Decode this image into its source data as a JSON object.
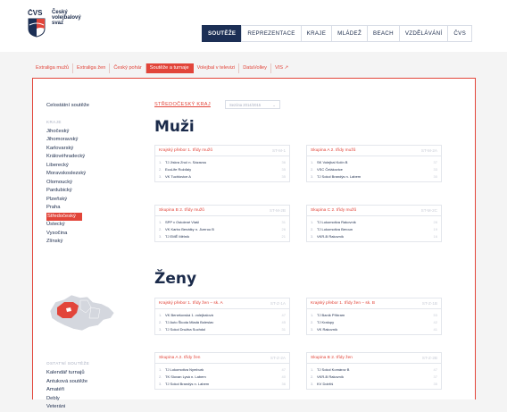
{
  "logo": {
    "line1": "ČVS",
    "line2": "Český",
    "line3": "volejbalový",
    "line4": "svaz"
  },
  "nav": [
    {
      "label": "SOUTĚŽE",
      "active": true
    },
    {
      "label": "REPREZENTACE"
    },
    {
      "label": "KRAJE"
    },
    {
      "label": "MLÁDEŽ"
    },
    {
      "label": "BEACH"
    },
    {
      "label": "VZDĚLÁVÁNÍ"
    },
    {
      "label": "ČVS"
    }
  ],
  "subnav": [
    {
      "label": "Extraliga mužů"
    },
    {
      "label": "Extraliga žen"
    },
    {
      "label": "Český pohár"
    },
    {
      "label": "Soutěže a turnaje",
      "active": true
    },
    {
      "label": "Volejbal v televizi"
    },
    {
      "label": "DataVolley"
    },
    {
      "label": "VIS ↗"
    }
  ],
  "sidebar": {
    "top": "Celostátní soutěže",
    "caption": "KRAJE",
    "regions": [
      "Jihočeský",
      "Jihomoravský",
      "Karlovarský",
      "Královéhradecký",
      "Liberecký",
      "Moravskoslezský",
      "Olomoucký",
      "Pardubický",
      "Plzeňský",
      "Praha",
      "Středočeský",
      "Ústecký",
      "Vysočina",
      "Zlínský"
    ],
    "active_region": "Středočeský",
    "bottom_caption": "OSTATNÍ SOUTĚŽE",
    "other": [
      "Kalendář turnajů",
      "Antuková soutěže",
      "Amatéři",
      "Debly",
      "Veteráni"
    ]
  },
  "main": {
    "region": "STŘEDOČESKÝ KRAJ",
    "season": "Sezóna 2014/2015",
    "men_title": "Muži",
    "women_title": "Ženy"
  },
  "cards": [
    {
      "title": "Krajský přebor 1. třídy mužů",
      "code": "ST-M-1",
      "rows": [
        [
          "1.",
          "TJ Jiskra Zruč n. Sázavou",
          "36"
        ],
        [
          "2.",
          "EcoLife Rožďaly",
          "35"
        ],
        [
          "3.",
          "VK Tuchlovice A",
          "35"
        ]
      ]
    },
    {
      "title": "Skupina A 2. třídy mužů",
      "code": "ST-M-2A",
      "rows": [
        [
          "1.",
          "SK Volejbal Kolín B",
          "37"
        ],
        [
          "2.",
          "VSC Čelákovice",
          "33"
        ],
        [
          "3.",
          "TJ Sokol Brandýs n. Labem",
          "30"
        ]
      ]
    },
    {
      "title": "Skupina B 2. třídy mužů",
      "code": "ST-M-2B",
      "rows": [
        [
          "1.",
          "SPP v Ostolené Vlašl",
          "31"
        ],
        [
          "2.",
          "VK Karbo Benátky n. Jizerou B",
          "26"
        ],
        [
          "3.",
          "TJ EMĚ Mělník",
          "21"
        ]
      ]
    },
    {
      "title": "Skupina C 2. třídy mužů",
      "code": "ST-M-2C",
      "rows": [
        [
          "1.",
          "TJ Lokomotiva Rakovník",
          "28"
        ],
        [
          "2.",
          "TJ Lokomotiva Beroun",
          "19"
        ],
        [
          "3.",
          "VKR-B Rakovník",
          "16"
        ]
      ]
    },
    {
      "title": "Krajský přebor 1. třídy žen – sk. A",
      "code": "ST-Z-1A",
      "rows": [
        [
          "1.",
          "VK Benešovská 1. volejbalová",
          "47"
        ],
        [
          "2.",
          "TJ Auto Škoda Mladá Boleslav",
          "45"
        ],
        [
          "3.",
          "TJ Sokol Družba Suchdol",
          "31"
        ]
      ]
    },
    {
      "title": "Krajský přebor 1. třídy žen – sk. B",
      "code": "ST-Z-1B",
      "rows": [
        [
          "1.",
          "TJ Baník Příbram",
          "53"
        ],
        [
          "2.",
          "TJ Kralupy",
          "42"
        ],
        [
          "3.",
          "VK Rakovník",
          "41"
        ]
      ]
    },
    {
      "title": "Skupina A 2. třídy žen",
      "code": "ST-Z-2A",
      "rows": [
        [
          "1.",
          "TJ Lokomotiva Nymburk",
          "47"
        ],
        [
          "2.",
          "TK Slovan Lysá n. Labem",
          "40"
        ],
        [
          "3.",
          "TJ Sokol Brandýs n. Labem",
          "36"
        ]
      ]
    },
    {
      "title": "Skupina B 2. třídy žen",
      "code": "ST-Z-2B",
      "rows": [
        [
          "1.",
          "TJ Sokol Komárov B",
          "47"
        ],
        [
          "2.",
          "VKR-B Rakovník",
          "37"
        ],
        [
          "3.",
          "KV Dobříš",
          "35"
        ]
      ]
    }
  ],
  "colors": {
    "accent": "#e2453a",
    "navy": "#1c2f55"
  }
}
